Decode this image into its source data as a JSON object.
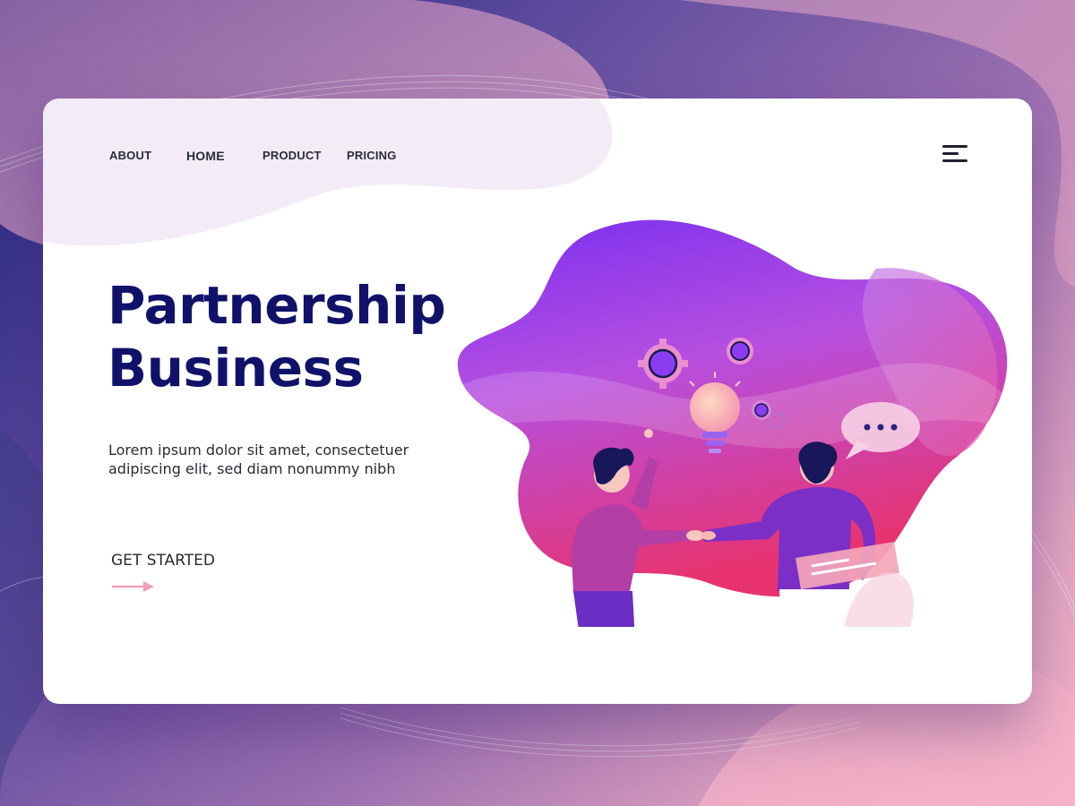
{
  "nav": {
    "items": [
      {
        "label": "ABOUT"
      },
      {
        "label": "HOME"
      },
      {
        "label": "PRODUCT"
      },
      {
        "label": "PRICING"
      }
    ],
    "menu_icon": "hamburger-menu-icon"
  },
  "hero": {
    "title_line1": "Partnership",
    "title_line2": "Business",
    "description": "Lorem ipsum dolor sit amet, consectetuer adipiscing elit, sed diam nonummy nibh",
    "cta_label": "GET STARTED",
    "cta_icon": "arrow-right-icon"
  },
  "illustration": {
    "name": "business-handshake-illustration",
    "icons": [
      "gear-icon",
      "lightbulb-icon",
      "speech-bubble-icon",
      "handshake-icon",
      "document-icon"
    ]
  },
  "colors": {
    "title": "#10126a",
    "accent_purple": "#8a3df0",
    "accent_pink": "#e23b7a",
    "arrow": "#f0a0bc"
  }
}
